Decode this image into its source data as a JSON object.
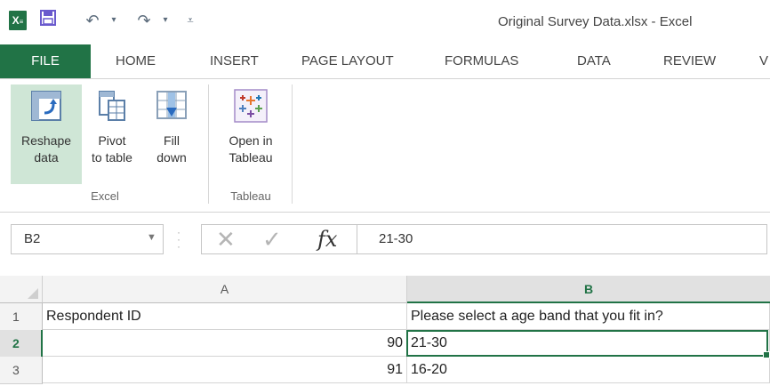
{
  "window": {
    "title": "Original Survey Data.xlsx - Excel"
  },
  "qat": {
    "save_icon": "save-icon",
    "undo_icon": "undo-icon",
    "redo_icon": "redo-icon",
    "customize_icon": "customize-qat-icon"
  },
  "tabs": [
    {
      "label": "FILE"
    },
    {
      "label": "HOME"
    },
    {
      "label": "INSERT"
    },
    {
      "label": "PAGE LAYOUT"
    },
    {
      "label": "FORMULAS"
    },
    {
      "label": "DATA"
    },
    {
      "label": "REVIEW"
    },
    {
      "label": "V"
    }
  ],
  "ribbon": {
    "excel_group": {
      "label": "Excel",
      "commands": [
        {
          "line1": "Reshape",
          "line2": "data"
        },
        {
          "line1": "Pivot",
          "line2": "to table"
        },
        {
          "line1": "Fill",
          "line2": "down"
        }
      ]
    },
    "tableau_group": {
      "label": "Tableau",
      "commands": [
        {
          "line1": "Open in",
          "line2": "Tableau"
        }
      ]
    }
  },
  "formula_bar": {
    "name_box": "B2",
    "fx_label": "fx",
    "formula": "21-30"
  },
  "sheet": {
    "columns": [
      "A",
      "B"
    ],
    "rows": [
      {
        "num": "1",
        "a": "Respondent ID",
        "b": "Please select a age band that you fit in?"
      },
      {
        "num": "2",
        "a": "90",
        "b": "21-30"
      },
      {
        "num": "3",
        "a": "91",
        "b": "16-20"
      }
    ]
  },
  "colors": {
    "accent": "#217346",
    "selected_cmd_bg": "#cfe6d6"
  }
}
